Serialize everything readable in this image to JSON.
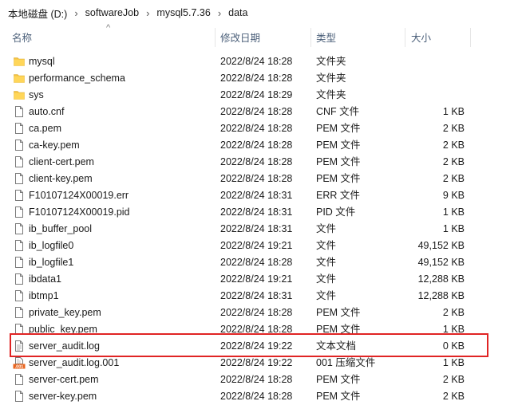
{
  "breadcrumb": [
    "本地磁盘 (D:)",
    "softwareJob",
    "mysql5.7.36",
    "data"
  ],
  "columns": {
    "name": "名称",
    "date": "修改日期",
    "type": "类型",
    "size": "大小"
  },
  "files": [
    {
      "icon": "folder",
      "name": "mysql",
      "date": "2022/8/24 18:28",
      "type": "文件夹",
      "size": ""
    },
    {
      "icon": "folder",
      "name": "performance_schema",
      "date": "2022/8/24 18:28",
      "type": "文件夹",
      "size": ""
    },
    {
      "icon": "folder",
      "name": "sys",
      "date": "2022/8/24 18:29",
      "type": "文件夹",
      "size": ""
    },
    {
      "icon": "file",
      "name": "auto.cnf",
      "date": "2022/8/24 18:28",
      "type": "CNF 文件",
      "size": "1 KB"
    },
    {
      "icon": "file",
      "name": "ca.pem",
      "date": "2022/8/24 18:28",
      "type": "PEM 文件",
      "size": "2 KB"
    },
    {
      "icon": "file",
      "name": "ca-key.pem",
      "date": "2022/8/24 18:28",
      "type": "PEM 文件",
      "size": "2 KB"
    },
    {
      "icon": "file",
      "name": "client-cert.pem",
      "date": "2022/8/24 18:28",
      "type": "PEM 文件",
      "size": "2 KB"
    },
    {
      "icon": "file",
      "name": "client-key.pem",
      "date": "2022/8/24 18:28",
      "type": "PEM 文件",
      "size": "2 KB"
    },
    {
      "icon": "file",
      "name": "F10107124X00019.err",
      "date": "2022/8/24 18:31",
      "type": "ERR 文件",
      "size": "9 KB"
    },
    {
      "icon": "file",
      "name": "F10107124X00019.pid",
      "date": "2022/8/24 18:31",
      "type": "PID 文件",
      "size": "1 KB"
    },
    {
      "icon": "file",
      "name": "ib_buffer_pool",
      "date": "2022/8/24 18:31",
      "type": "文件",
      "size": "1 KB"
    },
    {
      "icon": "file",
      "name": "ib_logfile0",
      "date": "2022/8/24 19:21",
      "type": "文件",
      "size": "49,152 KB"
    },
    {
      "icon": "file",
      "name": "ib_logfile1",
      "date": "2022/8/24 18:28",
      "type": "文件",
      "size": "49,152 KB"
    },
    {
      "icon": "file",
      "name": "ibdata1",
      "date": "2022/8/24 19:21",
      "type": "文件",
      "size": "12,288 KB"
    },
    {
      "icon": "file",
      "name": "ibtmp1",
      "date": "2022/8/24 18:31",
      "type": "文件",
      "size": "12,288 KB"
    },
    {
      "icon": "file",
      "name": "private_key.pem",
      "date": "2022/8/24 18:28",
      "type": "PEM 文件",
      "size": "2 KB"
    },
    {
      "icon": "file",
      "name": "public_key.pem",
      "date": "2022/8/24 18:28",
      "type": "PEM 文件",
      "size": "1 KB"
    },
    {
      "icon": "text-doc",
      "name": "server_audit.log",
      "date": "2022/8/24 19:22",
      "type": "文本文档",
      "size": "0 KB"
    },
    {
      "icon": "archive",
      "name": "server_audit.log.001",
      "date": "2022/8/24 19:22",
      "type": "001 压缩文件",
      "size": "1 KB"
    },
    {
      "icon": "file",
      "name": "server-cert.pem",
      "date": "2022/8/24 18:28",
      "type": "PEM 文件",
      "size": "2 KB"
    },
    {
      "icon": "file",
      "name": "server-key.pem",
      "date": "2022/8/24 18:28",
      "type": "PEM 文件",
      "size": "2 KB"
    }
  ],
  "highlighted_file": "server_audit.log",
  "colors": {
    "folder": "#f5c342",
    "highlight_border": "#e02424",
    "header_text": "#4c607a"
  }
}
